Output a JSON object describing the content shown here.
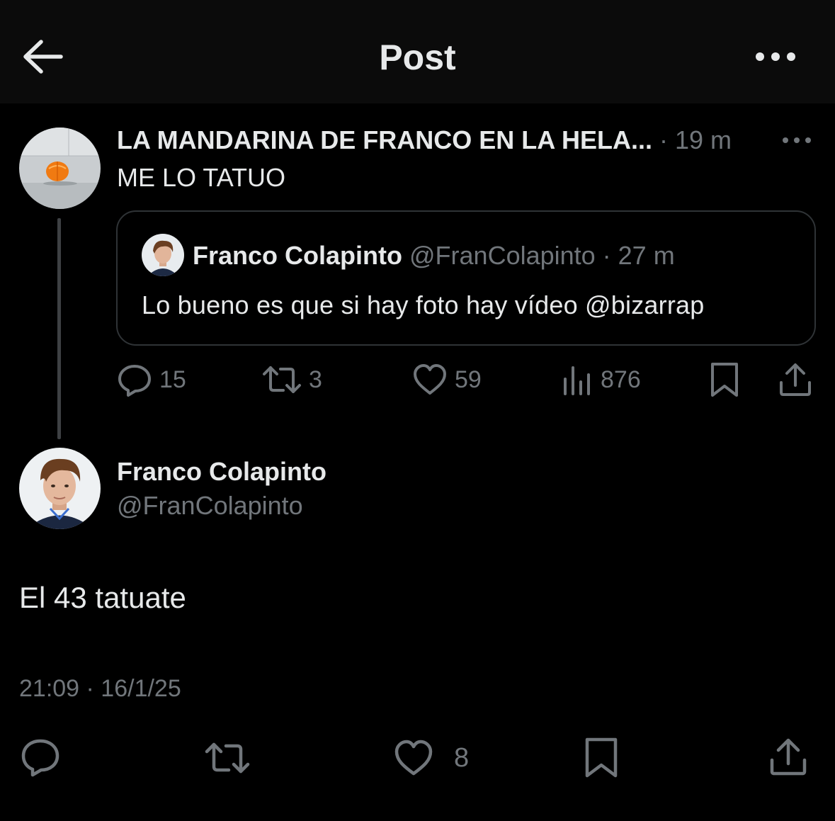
{
  "header": {
    "title": "Post",
    "back_icon": "arrow-left-icon",
    "more_icon": "more-horizontal-icon"
  },
  "parent": {
    "name": "LA MANDARINA DE FRANCO EN LA HELA...",
    "meta": " · 19 m",
    "text": "ME LO TATUO",
    "quote": {
      "name": "Franco Colapinto",
      "meta": " @FranColapinto · 27 m",
      "text": "Lo bueno es que si hay foto hay vídeo @bizarrap"
    },
    "actions": {
      "replies": "15",
      "reposts": "3",
      "likes": "59",
      "views": "876"
    }
  },
  "main": {
    "name": "Franco Colapinto",
    "handle": "@FranColapinto",
    "text": "El 43 tatuate",
    "timestamp": "21:09 · 16/1/25",
    "actions": {
      "likes": "8"
    }
  },
  "colors": {
    "background": "#000000",
    "header_bg": "#0b0b0b",
    "text_primary": "#e7e9ea",
    "text_secondary": "#71767b",
    "border": "#2f3336"
  }
}
